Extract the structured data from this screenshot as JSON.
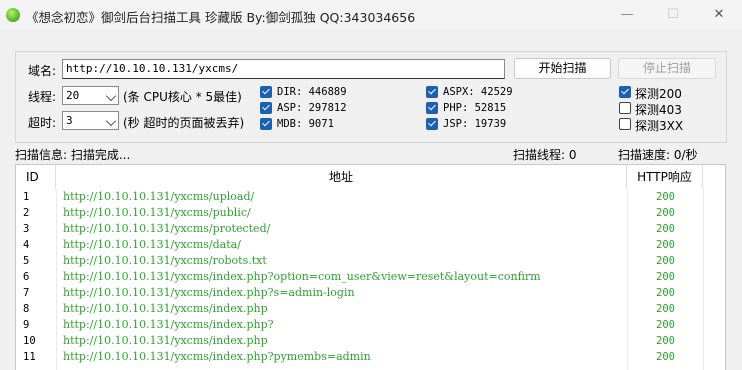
{
  "window": {
    "title": "《想念初恋》御剑后台扫描工具 珍藏版 By:御剑孤独 QQ:343034656",
    "minimize": "—",
    "maximize": "☐",
    "close": "✕"
  },
  "form": {
    "domain_label": "域名:",
    "domain_value": "http://10.10.10.131/yxcms/",
    "threads_label": "线程:",
    "threads_value": "20",
    "threads_hint": "(条 CPU核心 * 5最佳)",
    "timeout_label": "超时:",
    "timeout_value": "3",
    "timeout_hint": "(秒 超时的页面被丢弃)",
    "start_button": "开始扫描",
    "stop_button": "停止扫描"
  },
  "dictionaries": [
    {
      "label": "DIR: 446889",
      "checked": true
    },
    {
      "label": "ASP: 297812",
      "checked": true
    },
    {
      "label": "MDB: 9071",
      "checked": true
    },
    {
      "label": "ASPX: 42529",
      "checked": true
    },
    {
      "label": "PHP: 52815",
      "checked": true
    },
    {
      "label": "JSP: 19739",
      "checked": true
    }
  ],
  "probes": [
    {
      "label": "探测200",
      "checked": true
    },
    {
      "label": "探测403",
      "checked": false
    },
    {
      "label": "探测3XX",
      "checked": false
    }
  ],
  "status": {
    "info": "扫描信息: 扫描完成...",
    "threads": "扫描线程: 0",
    "speed": "扫描速度: 0/秒"
  },
  "table": {
    "headers": [
      "ID",
      "地址",
      "HTTP响应"
    ],
    "rows": [
      {
        "id": "1",
        "url": "http://10.10.10.131/yxcms/upload/",
        "code": "200"
      },
      {
        "id": "2",
        "url": "http://10.10.10.131/yxcms/public/",
        "code": "200"
      },
      {
        "id": "3",
        "url": "http://10.10.10.131/yxcms/protected/",
        "code": "200"
      },
      {
        "id": "4",
        "url": "http://10.10.10.131/yxcms/data/",
        "code": "200"
      },
      {
        "id": "5",
        "url": "http://10.10.10.131/yxcms/robots.txt",
        "code": "200"
      },
      {
        "id": "6",
        "url": "http://10.10.10.131/yxcms/index.php?option=com_user&view=reset&layout=confirm",
        "code": "200"
      },
      {
        "id": "7",
        "url": "http://10.10.10.131/yxcms/index.php?s=admin-login",
        "code": "200"
      },
      {
        "id": "8",
        "url": "http://10.10.10.131/yxcms/index.php",
        "code": "200"
      },
      {
        "id": "9",
        "url": "http://10.10.10.131/yxcms/index.php?",
        "code": "200"
      },
      {
        "id": "10",
        "url": "http://10.10.10.131/yxcms/index.php",
        "code": "200"
      },
      {
        "id": "11",
        "url": "http://10.10.10.131/yxcms/index.php?pymembs=admin",
        "code": "200"
      }
    ]
  },
  "colors": {
    "result_text": "#2fa12f",
    "checkbox_checked": "#1a5fb4"
  }
}
